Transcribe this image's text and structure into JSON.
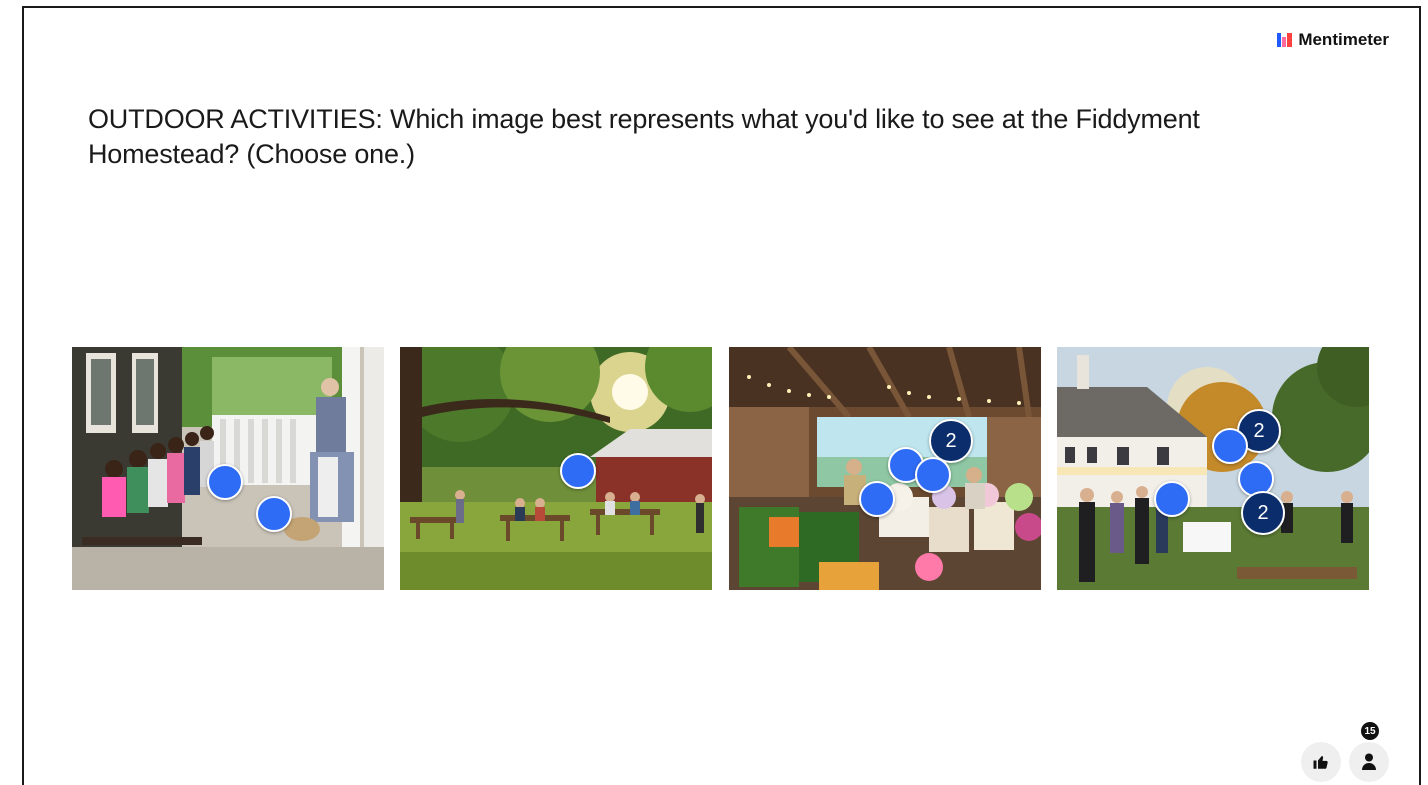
{
  "brand": {
    "name": "Mentimeter"
  },
  "question": {
    "text": "OUTDOOR ACTIVITIES: Which image best represents what you'd like to see at the Fiddyment Homestead? (Choose one.)"
  },
  "images": [
    {
      "id": "history-porch",
      "pins": [
        {
          "count": ""
        },
        {
          "count": ""
        }
      ]
    },
    {
      "id": "picnic-grove",
      "pins": [
        {
          "count": ""
        }
      ]
    },
    {
      "id": "farmers-market",
      "pins": [
        {
          "count": "2"
        },
        {
          "count": ""
        },
        {
          "count": ""
        },
        {
          "count": ""
        }
      ]
    },
    {
      "id": "evening-event",
      "pins": [
        {
          "count": "2"
        },
        {
          "count": ""
        },
        {
          "count": ""
        },
        {
          "count": ""
        },
        {
          "count": "2"
        }
      ]
    }
  ],
  "participants": {
    "count": "15"
  },
  "icons": {
    "like": "thumbs-up-icon",
    "people": "person-icon"
  },
  "colors": {
    "pin": "#2f6cf5",
    "cluster": "#0c2d6b"
  }
}
